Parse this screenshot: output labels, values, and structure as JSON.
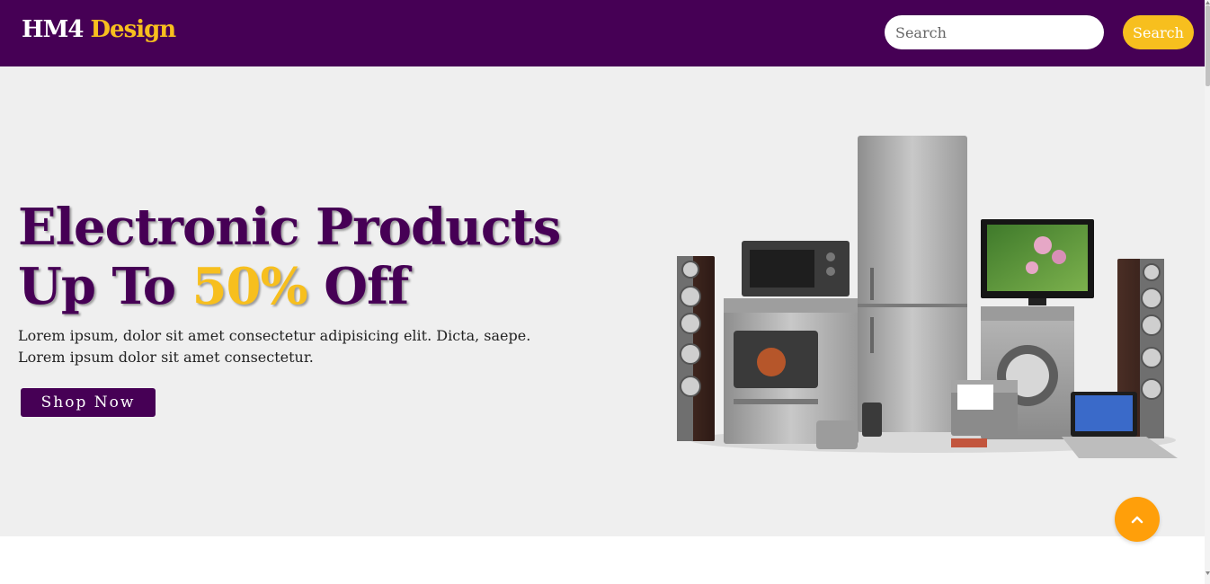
{
  "header": {
    "logo_main": "HM4",
    "logo_accent": "Design",
    "search_placeholder": "Search",
    "search_button_label": "Search"
  },
  "hero": {
    "title_line1": "Electronic Products",
    "title_line2_prefix": "Up To ",
    "title_line2_highlight": "50%",
    "title_line2_suffix": " Off",
    "description": "Lorem ipsum, dolor sit amet consectetur adipisicing elit. Dicta, saepe. Lorem ipsum dolor sit amet consectetur.",
    "shop_button_label": "Shop Now"
  },
  "colors": {
    "brand_purple": "#460055",
    "accent_yellow": "#f7bf1e",
    "scroll_top_orange": "#ff9f0a",
    "hero_background": "#efefef"
  },
  "icons": {
    "scroll_top": "chevron-up-icon",
    "hero_image": "home-appliances-image"
  }
}
